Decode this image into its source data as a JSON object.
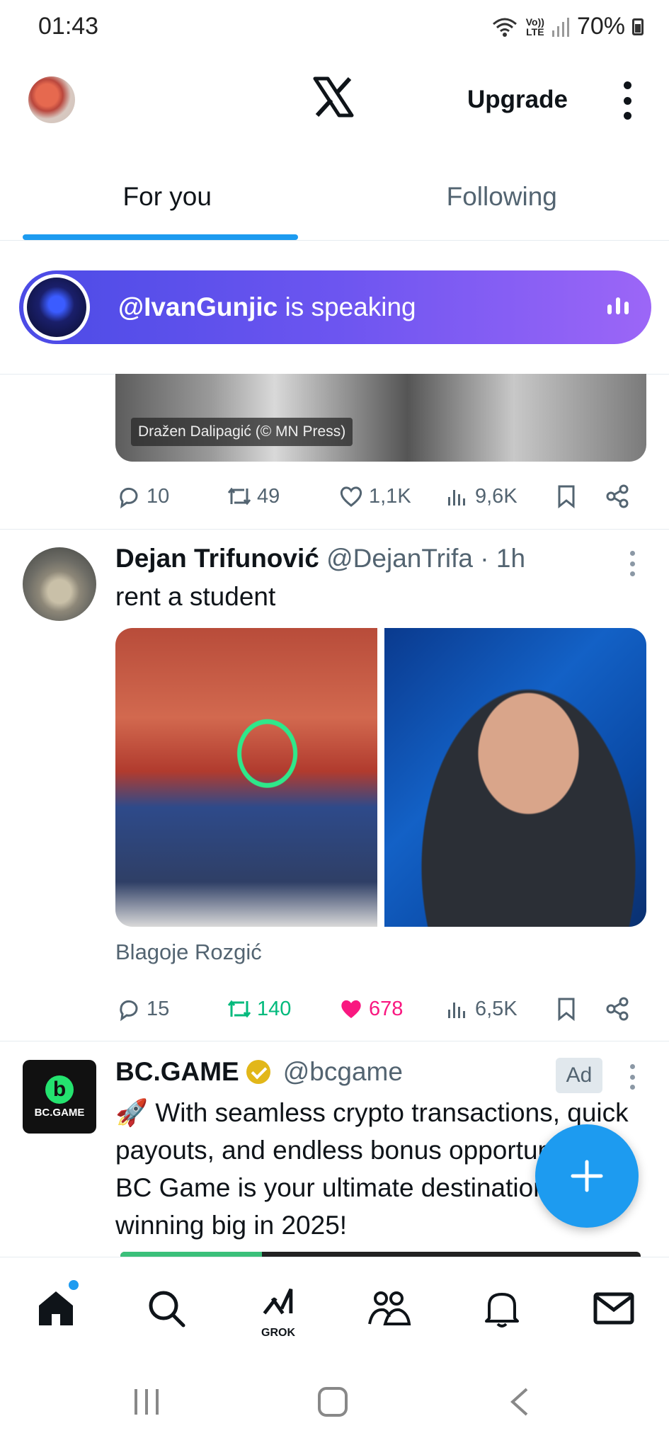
{
  "status_bar": {
    "time": "01:43",
    "network_top": "Vo))",
    "network_bottom": "LTE",
    "battery": "70%"
  },
  "header": {
    "upgrade_label": "Upgrade"
  },
  "tabs": [
    {
      "label": "For you",
      "active": true
    },
    {
      "label": "Following",
      "active": false
    }
  ],
  "space_banner": {
    "handle": "@IvanGunjic",
    "suffix": " is speaking"
  },
  "tweet1": {
    "image_credit": "Dražen Dalipagić (© MN Press)",
    "replies": "10",
    "retweets": "49",
    "likes": "1,1K",
    "views": "9,6K"
  },
  "tweet2": {
    "name": "Dejan Trifunović",
    "handle": "@DejanTrifa",
    "time": "· 1h",
    "text": "rent a student",
    "caption": "Blagoje Rozgić",
    "replies": "15",
    "retweets": "140",
    "likes": "678",
    "views": "6,5K",
    "retweeted": true,
    "liked": true
  },
  "tweet3": {
    "name": "BC.GAME",
    "handle": "@bcgame",
    "ad_label": "Ad",
    "avatar_text": "BC.GAME",
    "avatar_mark": "b",
    "text": "🚀 With seamless crypto transactions, quick payouts, and endless bonus opportunities, BC Game is your ultimate destination for winning big in 2025!"
  },
  "bottom_nav": {
    "items": [
      "home-icon",
      "search-icon",
      "grok-icon",
      "communities-icon",
      "notifications-icon",
      "messages-icon"
    ],
    "grok_label": "GROK"
  },
  "colors": {
    "accent": "#1d9bf0",
    "retweet_active": "#00ba7c",
    "like_active": "#f91880",
    "muted": "#536471"
  }
}
